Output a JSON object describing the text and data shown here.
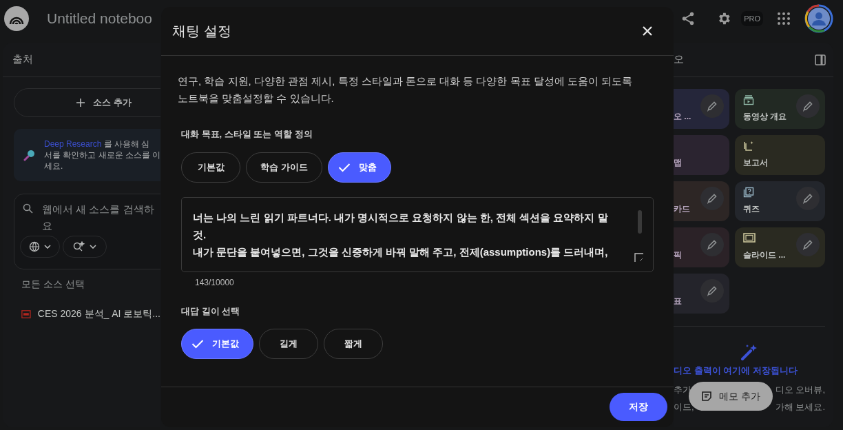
{
  "app_bar": {
    "title": "Untitled noteboo",
    "badge": "PRO"
  },
  "sources_panel": {
    "title": "출처",
    "add_button": "소스 추가",
    "research_card": {
      "link": "Deep Research",
      "text": "를 사용해 심\n서를 확인하고 새로운 소스를 이\n세요."
    },
    "search": {
      "placeholder": "웹에서 새 소스를 검색하\n요"
    },
    "select_all": "모든 소스 선택",
    "sources": [
      {
        "name": "CES 2026 분석_ AI 로보틱..."
      }
    ]
  },
  "studio_panel": {
    "title": "오",
    "tiles": [
      {
        "label": "오 ...",
        "color": "#25263a",
        "editable": true
      },
      {
        "label": "동영상 개요",
        "color": "#222923",
        "editable": true,
        "kind": "video"
      },
      {
        "label": "맵",
        "color": "#2b2430",
        "editable": false
      },
      {
        "label": "보고서",
        "color": "#2a2a21",
        "editable": false,
        "kind": "report"
      },
      {
        "label": "카드",
        "color": "#2d2625",
        "editable": true
      },
      {
        "label": "퀴즈",
        "color": "#23262c",
        "editable": true,
        "kind": "quiz"
      },
      {
        "label": "픽",
        "color": "#2b2227",
        "editable": true
      },
      {
        "label": "슬라이드 ...",
        "color": "#2a2a21",
        "editable": true,
        "kind": "slides"
      },
      {
        "label": "표",
        "color": "#24242b",
        "editable": true
      }
    ],
    "empty_title": "디오 출력이 여기에 저장됩니다",
    "empty_lines": [
      [
        "추가",
        "디오 오버뷰,"
      ],
      [
        "이드,",
        "가해 보세요."
      ]
    ],
    "note_button": "메모 추가"
  },
  "dialog": {
    "title": "채팅 설정",
    "description": "연구, 학습 지원, 다양한 관점 제시, 특정 스타일과 톤으로 대화 등 다양한 목표 달성에 도움이 되도록\n노트북을 맞춤설정할 수 있습니다.",
    "goal_label": "대화 목표, 스타일 또는 역할 정의",
    "goal_options": [
      {
        "label": "기본값",
        "selected": false
      },
      {
        "label": "학습 가이드",
        "selected": false
      },
      {
        "label": "맞춤",
        "selected": true
      }
    ],
    "prompt": {
      "value": "너는 나의 느린 읽기 파트너다. 내가 명시적으로 요청하지 않는 한, 전체 섹션을 요약하지 말\n것.\n내가 문단을 붙여넣으면, 그것을 신중하게 바꿔 말해 주고, 전제(assumptions)를 드러내며,"
    },
    "counter": "143/10000",
    "length_label": "대답 길이 선택",
    "length_options": [
      {
        "label": "기본값",
        "selected": true
      },
      {
        "label": "길게",
        "selected": false
      },
      {
        "label": "짧게",
        "selected": false
      }
    ],
    "save_button": "저장"
  }
}
